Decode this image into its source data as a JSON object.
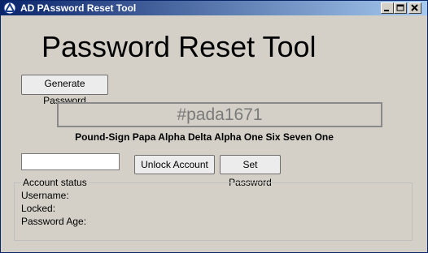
{
  "window": {
    "title": "AD PAssword Reset Tool",
    "controls": {
      "minimize": "minimize",
      "maximize": "maximize",
      "close": "close"
    }
  },
  "heading": "Password Reset Tool",
  "buttons": {
    "generate": "Generate Password",
    "unlock": "Unlock Account",
    "set_password": "Set Password"
  },
  "password": {
    "value": "#pada1671",
    "phonetic": "Pound-Sign Papa Alpha Delta Alpha One Six Seven One"
  },
  "account_input": {
    "value": "",
    "placeholder": ""
  },
  "status": {
    "legend": "Account status",
    "username_label": "Username:",
    "locked_label": "Locked:",
    "password_age_label": "Password Age:"
  },
  "colors": {
    "titlebar_start": "#0a246a",
    "titlebar_end": "#a6caf0",
    "window_bg": "#d4d0c8"
  }
}
